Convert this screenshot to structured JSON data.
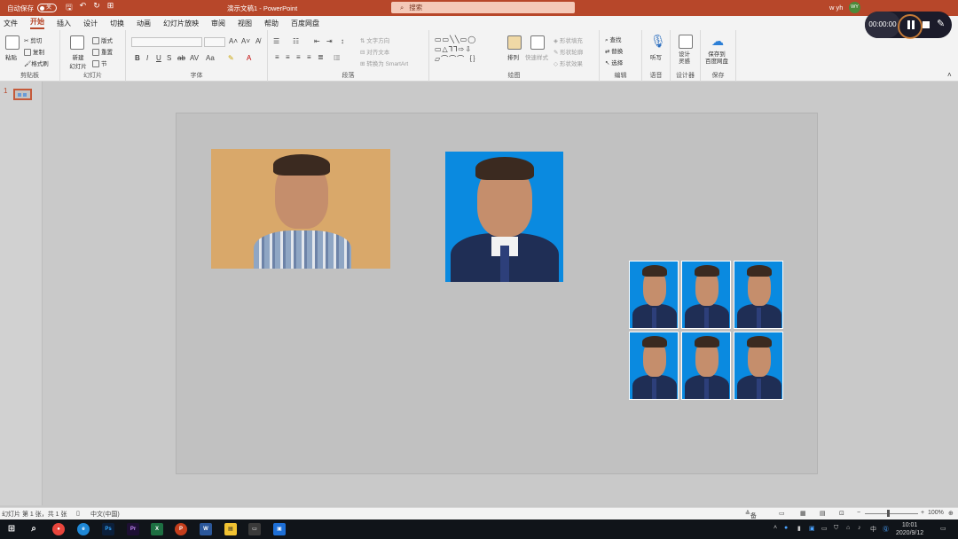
{
  "titlebar": {
    "autosave_label": "自动保存",
    "autosave_state": "关",
    "doc_title": "演示文稿1 - PowerPoint",
    "search_placeholder": "搜索",
    "user_name": "w yh",
    "user_initials": "WY"
  },
  "tabs": [
    "文件",
    "开始",
    "插入",
    "设计",
    "切换",
    "动画",
    "幻灯片放映",
    "审阅",
    "视图",
    "帮助",
    "百度网盘"
  ],
  "active_tab": "开始",
  "ribbon": {
    "clipboard": {
      "label": "剪贴板",
      "paste": "粘贴",
      "cut": "剪切",
      "copy": "复制",
      "format_painter": "格式刷"
    },
    "slides": {
      "label": "幻灯片",
      "new_slide": "新建\n幻灯片",
      "layout": "版式",
      "reset": "重置",
      "section": "节"
    },
    "font": {
      "label": "字体"
    },
    "paragraph": {
      "label": "段落",
      "text_direction": "文字方向",
      "align_text": "对齐文本",
      "smartart": "转换为 SmartArt"
    },
    "drawing": {
      "label": "绘图",
      "arrange": "排列",
      "quick_styles": "快速样式",
      "shape_fill": "形状填充",
      "shape_outline": "形状轮廓",
      "shape_effects": "形状效果"
    },
    "editing": {
      "label": "编辑",
      "find": "查找",
      "replace": "替换",
      "select": "选择"
    },
    "voice": {
      "label": "语音",
      "dictate": "听写"
    },
    "designer": {
      "label": "设计器",
      "design_ideas": "设计\n灵感"
    },
    "save": {
      "label": "保存",
      "save_to_baidu": "保存到\n百度网盘"
    }
  },
  "slide_pane": {
    "slide_number": "1"
  },
  "recorder": {
    "time": "00:00:00"
  },
  "statusbar": {
    "slide_info": "幻灯片 第 1 张，共 1 张",
    "language": "中文(中国)",
    "notes": "备注",
    "zoom": "100%"
  },
  "taskbar": {
    "time": "10:01",
    "date": "2020/9/12",
    "ime": "中"
  },
  "colors": {
    "accent": "#b7472a",
    "photo_blue": "#0a8ae0",
    "photo_warm": "#d9a86a"
  }
}
